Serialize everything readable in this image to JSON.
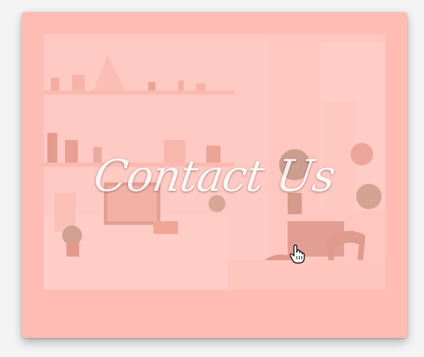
{
  "card": {
    "heading": "Contact Us",
    "background_color": "#ffbcb4",
    "image_description_icon": "room-photo"
  },
  "cursor": {
    "icon": "hand-pointer-icon"
  }
}
